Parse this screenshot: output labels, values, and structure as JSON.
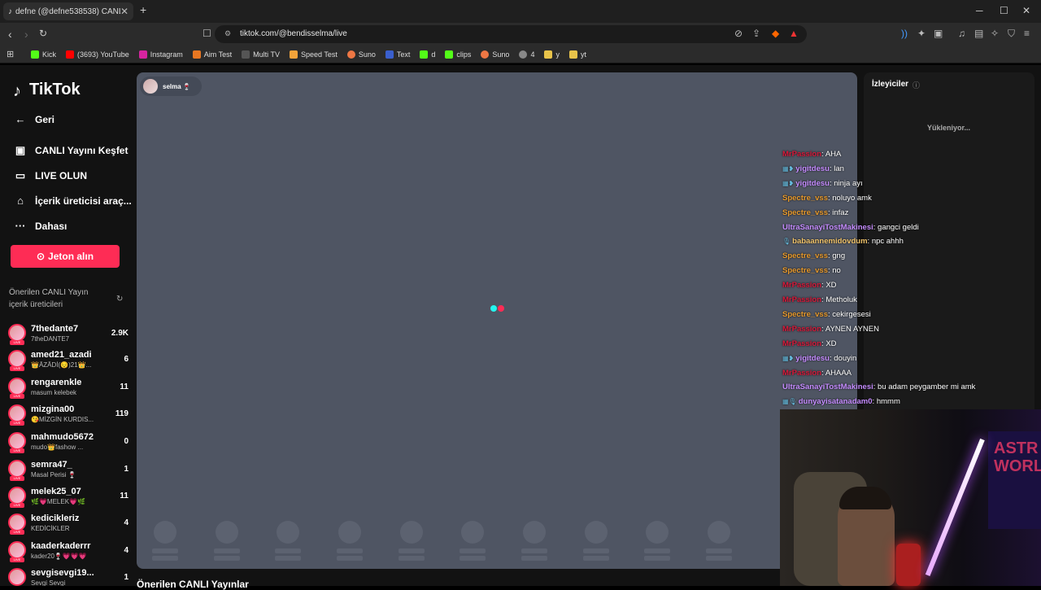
{
  "browser": {
    "tab_title": "defne (@defne538538) CANLI",
    "url": "tiktok.com/@bendisselma/live",
    "bookmarks": [
      "Kick",
      "(3693) YouTube",
      "Instagram",
      "Aim Test",
      "Multi TV",
      "Speed Test",
      "Suno",
      "Text",
      "d",
      "clips",
      "Suno",
      "4",
      "y",
      "yt"
    ]
  },
  "sidebar": {
    "logo": "TikTok",
    "back": "Geri",
    "items": [
      "CANLI Yayını Keşfet",
      "LIVE OLUN",
      "İçerik üreticisi araç...",
      "Dahası"
    ],
    "coin_button": "Jeton alın",
    "suggested_title": "Önerilen CANLI Yayın içerik üreticileri",
    "creators": [
      {
        "name": "7thedante7",
        "sub": "7theDANTE7",
        "count": "2.9K"
      },
      {
        "name": "amed21_azadi",
        "sub": "👑ÂZÂDİ(😔)21👑...",
        "count": "6"
      },
      {
        "name": "rengarenkle",
        "sub": "masum kelebek",
        "count": "11"
      },
      {
        "name": "mizgina00",
        "sub": "😘MİZGİN KURDIS...",
        "count": "119"
      },
      {
        "name": "mahmudo5672",
        "sub": "mudo👑fashow ...",
        "count": "0"
      },
      {
        "name": "semra47_",
        "sub": "Masal Perisi 🍷",
        "count": "1"
      },
      {
        "name": "melek25_07",
        "sub": "🌿💗MELEK💗🌿",
        "count": "11"
      },
      {
        "name": "kedicikleriz",
        "sub": "KEDİCİKLER",
        "count": "4"
      },
      {
        "name": "kaaderkaderrr",
        "sub": "kader20🍷💗💗💗",
        "count": "4"
      },
      {
        "name": "sevgisevgi19...",
        "sub": "Sevgi Sevgi",
        "count": "1"
      }
    ]
  },
  "stream": {
    "host": "selma 🍷",
    "recommended_title": "Önerilen CANLI Yayınlar"
  },
  "viewers": {
    "title": "İzleyiciler",
    "loading": "Yükleniyor..."
  },
  "chat": [
    {
      "user": "MrPassion",
      "msg": "AHA",
      "color": "#d8193a",
      "badge": ""
    },
    {
      "user": "yigitdesu",
      "msg": "lan",
      "color": "#c58cff",
      "badge": "▦❥"
    },
    {
      "user": "yigitdesu",
      "msg": "ninja ayı",
      "color": "#c58cff",
      "badge": "▦❥"
    },
    {
      "user": "Spectre_vss",
      "msg": "noluyo amk",
      "color": "#e89a2c",
      "badge": ""
    },
    {
      "user": "Spectre_vss",
      "msg": "infaz",
      "color": "#e89a2c",
      "badge": ""
    },
    {
      "user": "UltraSanayiTostMakinesi",
      "msg": "gangci geldi",
      "color": "#c58cff",
      "badge": ""
    },
    {
      "user": "babaannemidovdum",
      "msg": "npc ahhh",
      "color": "#f0c36a",
      "badge": "🎙"
    },
    {
      "user": "Spectre_vss",
      "msg": "gng",
      "color": "#e89a2c",
      "badge": ""
    },
    {
      "user": "Spectre_vss",
      "msg": "no",
      "color": "#e89a2c",
      "badge": ""
    },
    {
      "user": "MrPassion",
      "msg": "XD",
      "color": "#d8193a",
      "badge": ""
    },
    {
      "user": "MrPassion",
      "msg": "Metholuk",
      "color": "#d8193a",
      "badge": ""
    },
    {
      "user": "Spectre_vss",
      "msg": "cekirgesesi",
      "color": "#e89a2c",
      "badge": ""
    },
    {
      "user": "MrPassion",
      "msg": "AYNEN AYNEN",
      "color": "#d8193a",
      "badge": ""
    },
    {
      "user": "MrPassion",
      "msg": "XD",
      "color": "#d8193a",
      "badge": ""
    },
    {
      "user": "yigitdesu",
      "msg": "douyin",
      "color": "#c58cff",
      "badge": "▦❥"
    },
    {
      "user": "MrPassion",
      "msg": "AHAAA",
      "color": "#d8193a",
      "badge": ""
    },
    {
      "user": "UltraSanayiTostMakinesi",
      "msg": "bu adam peygamber mi amk",
      "color": "#c58cff",
      "badge": ""
    },
    {
      "user": "dunyayisatanadam0",
      "msg": "hmmm",
      "color": "#c58cff",
      "badge": "▦🎙"
    }
  ],
  "webcam": {
    "poster_text": "ASTR\nWORLD"
  },
  "colors": {
    "accent": "#fe2c55",
    "video_bg": "#4f5563"
  }
}
